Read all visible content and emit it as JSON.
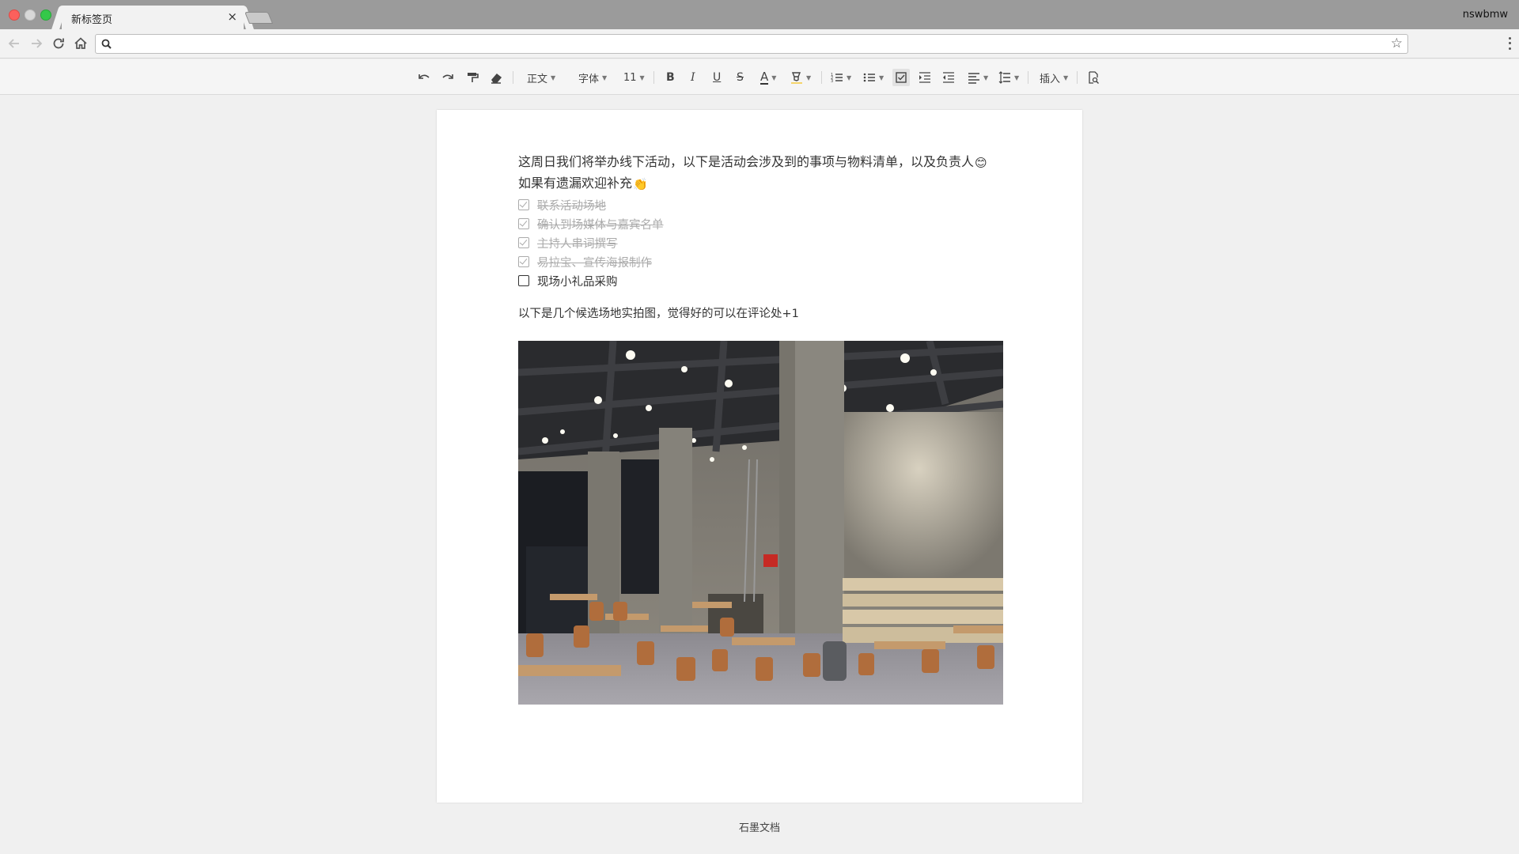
{
  "window": {
    "tab_title": "新标签页",
    "tab_close": "×",
    "profile_name": "nswbmw"
  },
  "address_bar": {
    "value": "",
    "placeholder": ""
  },
  "toolbar": {
    "style_label": "正文",
    "font_label": "字体",
    "size_label": "11",
    "bold": "B",
    "italic": "I",
    "underline": "U",
    "strike": "S",
    "font_color": "A",
    "insert_label": "插入"
  },
  "document": {
    "intro_line1": "这周日我们将举办线下活动，以下是活动会涉及到的事项与物料清单，以及负责人",
    "intro_emoji1": "😊",
    "intro_line2": "如果有遗漏欢迎补充",
    "intro_emoji2": "👏",
    "tasks": [
      {
        "text": "联系活动场地",
        "done": true
      },
      {
        "text": "确认到场媒体与嘉宾名单",
        "done": true
      },
      {
        "text": "主持人串词撰写",
        "done": true
      },
      {
        "text": "易拉宝、宣传海报制作",
        "done": true
      },
      {
        "text": "现场小礼品采购",
        "done": false
      }
    ],
    "photo_caption": "以下是几个候选场地实拍图，觉得好的可以在评论处+1"
  },
  "footer": {
    "brand": "石墨文档"
  }
}
